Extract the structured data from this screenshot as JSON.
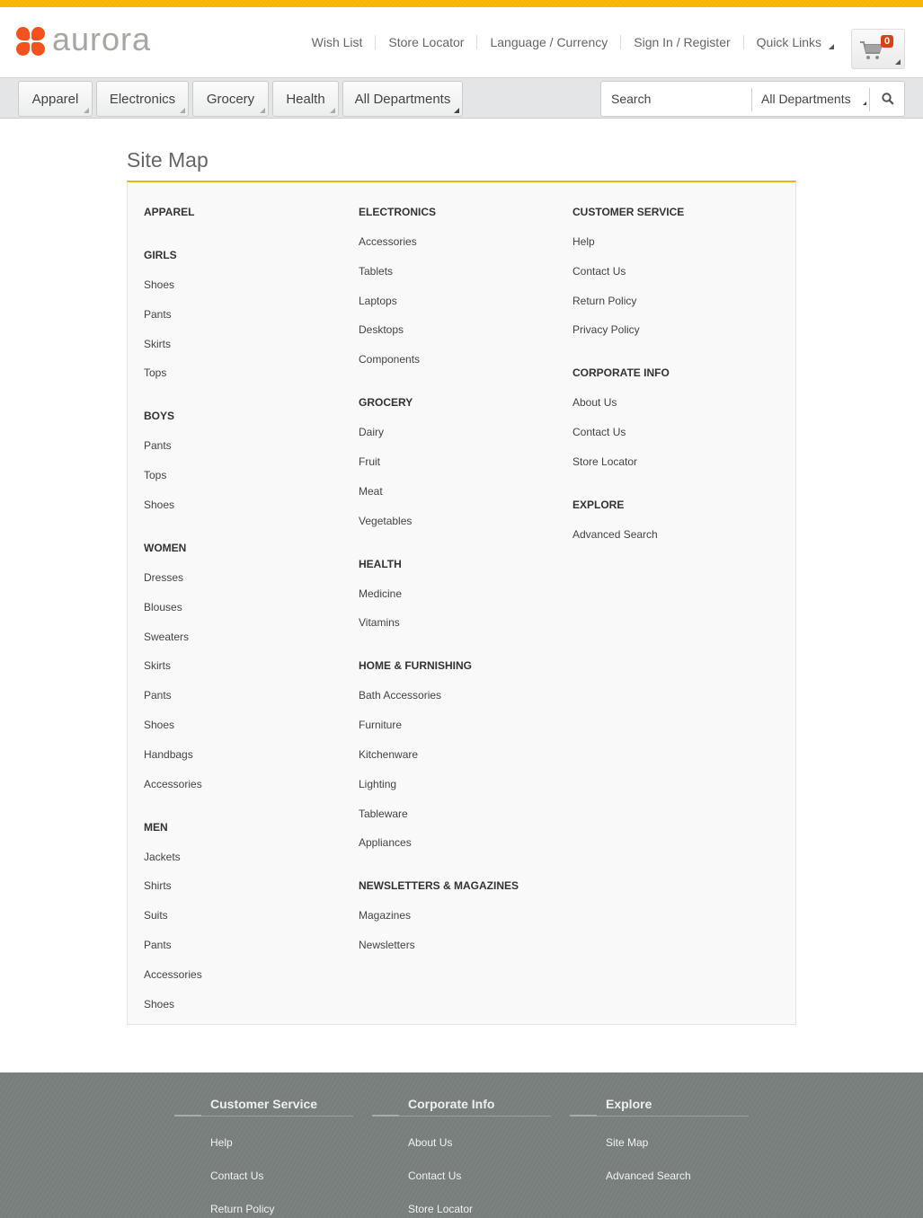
{
  "brand": {
    "name": "aurora",
    "accent": "#f4511e",
    "stripe": "#f7b500"
  },
  "header": {
    "util_links": [
      "Wish List",
      "Store Locator",
      "Language / Currency",
      "Sign In / Register",
      "Quick Links"
    ],
    "cart_count": "0"
  },
  "nav": {
    "departments": [
      "Apparel",
      "Electronics",
      "Grocery",
      "Health",
      "All Departments"
    ],
    "search": {
      "placeholder": "Search",
      "scope": "All Departments"
    }
  },
  "page_title": "Site Map",
  "sitemap": {
    "col1": [
      {
        "type": "cat",
        "text": "APPAREL"
      },
      {
        "type": "cat",
        "text": "GIRLS"
      },
      {
        "type": "lnk",
        "text": "Shoes"
      },
      {
        "type": "lnk",
        "text": "Pants"
      },
      {
        "type": "lnk",
        "text": "Skirts"
      },
      {
        "type": "lnk",
        "text": "Tops"
      },
      {
        "type": "cat",
        "text": "BOYS"
      },
      {
        "type": "lnk",
        "text": "Pants"
      },
      {
        "type": "lnk",
        "text": "Tops"
      },
      {
        "type": "lnk",
        "text": "Shoes"
      },
      {
        "type": "cat",
        "text": "WOMEN"
      },
      {
        "type": "lnk",
        "text": "Dresses"
      },
      {
        "type": "lnk",
        "text": "Blouses"
      },
      {
        "type": "lnk",
        "text": "Sweaters"
      },
      {
        "type": "lnk",
        "text": "Skirts"
      },
      {
        "type": "lnk",
        "text": "Pants"
      },
      {
        "type": "lnk",
        "text": "Shoes"
      },
      {
        "type": "lnk",
        "text": "Handbags"
      },
      {
        "type": "lnk",
        "text": "Accessories"
      },
      {
        "type": "cat",
        "text": "MEN"
      },
      {
        "type": "lnk",
        "text": "Jackets"
      },
      {
        "type": "lnk",
        "text": "Shirts"
      },
      {
        "type": "lnk",
        "text": "Suits"
      },
      {
        "type": "lnk",
        "text": "Pants"
      },
      {
        "type": "lnk",
        "text": "Accessories"
      },
      {
        "type": "lnk",
        "text": "Shoes"
      }
    ],
    "col2": [
      {
        "type": "cat",
        "text": "ELECTRONICS"
      },
      {
        "type": "lnk",
        "text": "Accessories"
      },
      {
        "type": "lnk",
        "text": "Tablets"
      },
      {
        "type": "lnk",
        "text": "Laptops"
      },
      {
        "type": "lnk",
        "text": "Desktops"
      },
      {
        "type": "lnk",
        "text": "Components"
      },
      {
        "type": "cat",
        "text": "GROCERY"
      },
      {
        "type": "lnk",
        "text": "Dairy"
      },
      {
        "type": "lnk",
        "text": "Fruit"
      },
      {
        "type": "lnk",
        "text": "Meat"
      },
      {
        "type": "lnk",
        "text": "Vegetables"
      },
      {
        "type": "cat",
        "text": "HEALTH"
      },
      {
        "type": "lnk",
        "text": "Medicine"
      },
      {
        "type": "lnk",
        "text": "Vitamins"
      },
      {
        "type": "cat",
        "text": "HOME & FURNISHING"
      },
      {
        "type": "lnk",
        "text": "Bath Accessories"
      },
      {
        "type": "lnk",
        "text": "Furniture"
      },
      {
        "type": "lnk",
        "text": "Kitchenware"
      },
      {
        "type": "lnk",
        "text": "Lighting"
      },
      {
        "type": "lnk",
        "text": "Tableware"
      },
      {
        "type": "lnk",
        "text": "Appliances"
      },
      {
        "type": "cat",
        "text": "NEWSLETTERS & MAGAZINES"
      },
      {
        "type": "lnk",
        "text": "Magazines"
      },
      {
        "type": "lnk",
        "text": "Newsletters"
      }
    ],
    "col3": [
      {
        "type": "cat",
        "text": "CUSTOMER SERVICE"
      },
      {
        "type": "lnk",
        "text": "Help"
      },
      {
        "type": "lnk",
        "text": "Contact Us"
      },
      {
        "type": "lnk",
        "text": "Return Policy"
      },
      {
        "type": "lnk",
        "text": "Privacy Policy"
      },
      {
        "type": "cat",
        "text": "CORPORATE INFO"
      },
      {
        "type": "lnk",
        "text": "About Us"
      },
      {
        "type": "lnk",
        "text": "Contact Us"
      },
      {
        "type": "lnk",
        "text": "Store Locator"
      },
      {
        "type": "cat",
        "text": "EXPLORE"
      },
      {
        "type": "lnk",
        "text": "Advanced Search"
      }
    ]
  },
  "footer": {
    "columns": [
      {
        "title": "Customer Service",
        "links": [
          "Help",
          "Contact Us",
          "Return Policy"
        ]
      },
      {
        "title": "Corporate Info",
        "links": [
          "About Us",
          "Contact Us",
          "Store Locator"
        ]
      },
      {
        "title": "Explore",
        "links": [
          "Site Map",
          "Advanced Search"
        ]
      }
    ]
  }
}
